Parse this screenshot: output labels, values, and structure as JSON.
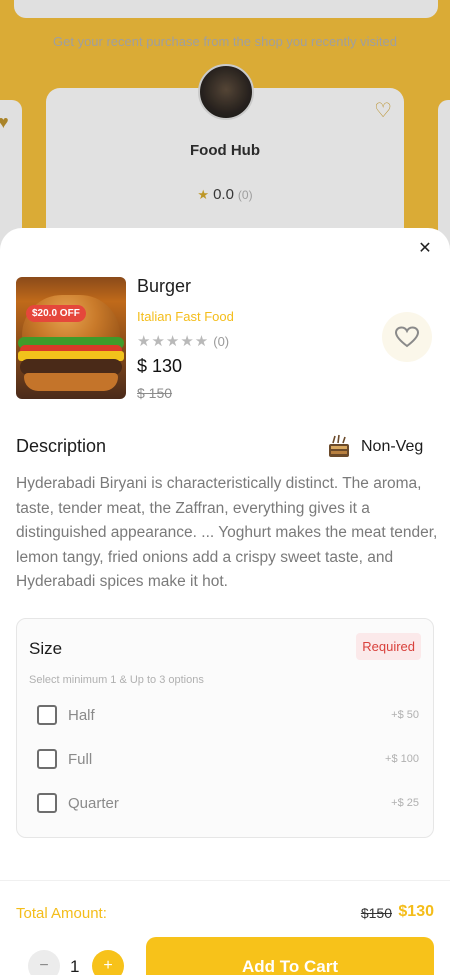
{
  "background": {
    "subtitle": "Get your recent purchase from the shop you recently visited",
    "shop": {
      "name": "Food Hub",
      "rating": "0.0",
      "rating_count": "(0)"
    }
  },
  "sheet": {
    "close_icon": "close-icon",
    "product": {
      "name": "Burger",
      "category": "Italian Fast Food",
      "discount_badge": "$20.0 OFF",
      "stars": "★★★★★",
      "rating_count": "(0)",
      "price": "$ 130",
      "old_price": "$ 150"
    },
    "description": {
      "title": "Description",
      "veg_label": "Non-Veg",
      "text": "Hyderabadi Biryani is characteristically distinct. The aroma, taste, tender meat, the Zaffran, everything gives it a distinguished appearance. ... Yoghurt makes the meat tender, lemon tangy, fried onions add a crispy sweet taste, and Hyderabadi spices make it hot."
    },
    "size": {
      "title": "Size",
      "required_label": "Required",
      "hint": "Select minimum 1 & Up to 3 options",
      "options": [
        {
          "label": "Half",
          "price": "+$ 50"
        },
        {
          "label": "Full",
          "price": "+$ 100"
        },
        {
          "label": "Quarter",
          "price": "+$ 25"
        }
      ]
    }
  },
  "footer": {
    "total_label": "Total Amount:",
    "total_old": "$150",
    "total_new": "$130",
    "quantity": "1",
    "minus": "−",
    "plus": "+",
    "add_to_cart": "Add To Cart"
  },
  "colors": {
    "accent": "#f7c21a",
    "discount": "#e5473b",
    "required": "#d9413c"
  }
}
